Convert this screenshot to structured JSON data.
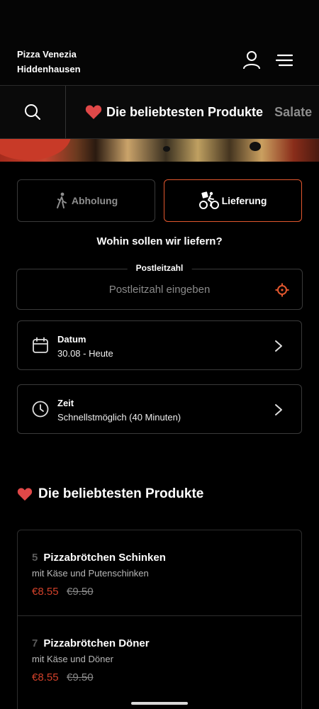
{
  "header": {
    "restaurant_name": "Pizza Venezia",
    "restaurant_city": "Hiddenhausen",
    "icons": [
      "user-icon",
      "menu-icon"
    ]
  },
  "categories": {
    "search_icon": "search-icon",
    "items": [
      {
        "label": "Die beliebtesten Produkte",
        "active": true
      },
      {
        "label": "Salate",
        "active": false
      }
    ]
  },
  "order_mode": {
    "pickup_label": "Abholung",
    "delivery_label": "Lieferung",
    "selected": "Lieferung"
  },
  "delivery": {
    "question": "Wohin sollen wir liefern?",
    "zip_label": "Postleitzahl",
    "zip_placeholder": "Postleitzahl eingeben",
    "zip_value": ""
  },
  "date_picker": {
    "title": "Datum",
    "value": "30.08 - Heute"
  },
  "time_picker": {
    "title": "Zeit",
    "value": "Schnellstmöglich (40 Minuten)"
  },
  "popular": {
    "title": "Die beliebtesten Produkte",
    "products": [
      {
        "number": "5",
        "name": "Pizzabrötchen Schinken",
        "description": "mit Käse und Putenschinken",
        "price": "€8.55",
        "old_price": "€9.50"
      },
      {
        "number": "7",
        "name": "Pizzabrötchen Döner",
        "description": "mit Käse und Döner",
        "price": "€8.55",
        "old_price": "€9.50"
      }
    ]
  },
  "colors": {
    "accent": "#e2572e",
    "price": "#d2412a",
    "heart": "#e04848",
    "background": "#000000"
  }
}
